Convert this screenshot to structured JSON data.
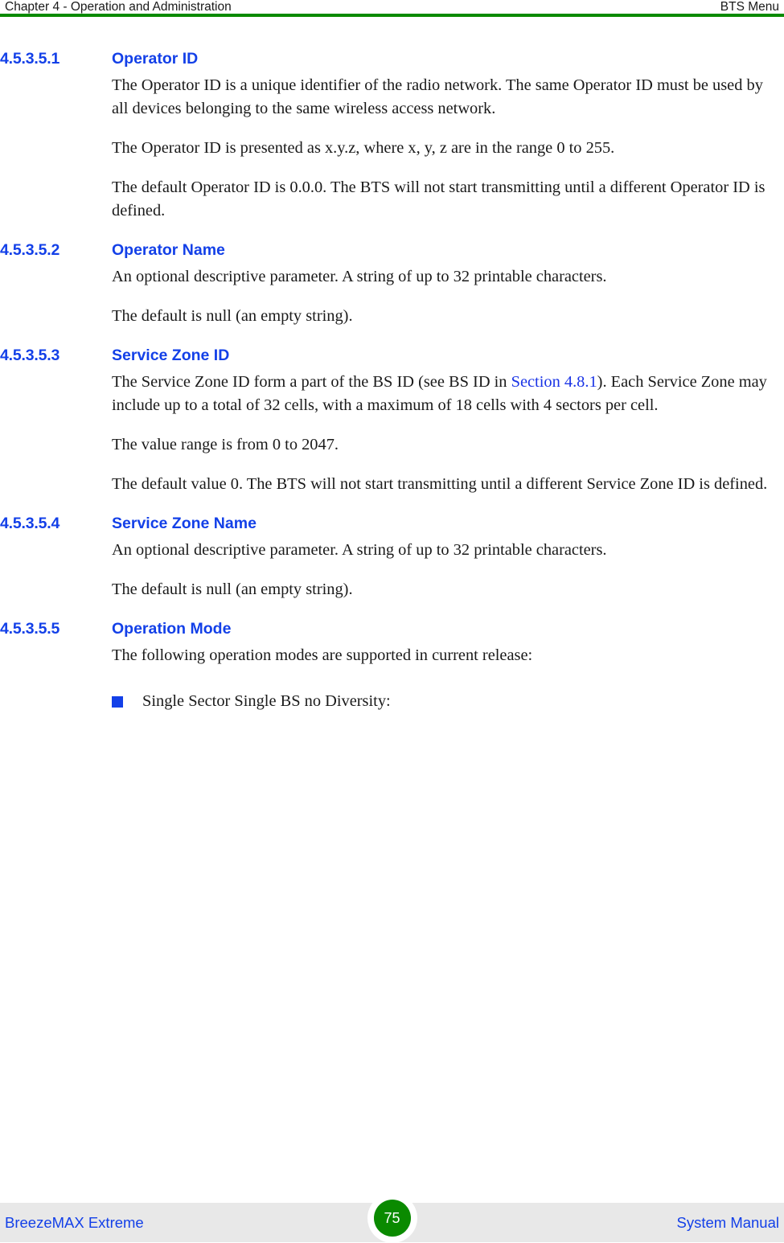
{
  "header": {
    "left": "Chapter 4 - Operation and Administration",
    "right": "BTS Menu",
    "rule_color": "#0a8a00"
  },
  "theme": {
    "heading_color": "#1340e8",
    "link_color": "#1a34e6",
    "body_color": "#1a1a1a",
    "footer_band_color": "#e8e8e8",
    "badge_color": "#0a8a00",
    "bullet_color": "#1340e8"
  },
  "sections": [
    {
      "number": "4.5.3.5.1",
      "title": "Operator ID",
      "paragraphs": [
        "The Operator ID is a unique identifier of the radio network. The same Operator ID must be used by all devices belonging to the same wireless access network.",
        "The Operator ID is presented as x.y.z, where x, y, z are in the range 0 to 255.",
        "The default Operator ID is 0.0.0. The BTS will not start transmitting until a different Operator ID is defined."
      ]
    },
    {
      "number": "4.5.3.5.2",
      "title": "Operator Name",
      "paragraphs": [
        "An optional descriptive parameter. A string of up to 32 printable characters.",
        "The default is null (an empty string)."
      ]
    },
    {
      "number": "4.5.3.5.3",
      "title": "Service Zone ID",
      "paragraphs_rich": [
        {
          "parts": [
            {
              "type": "text",
              "value": "The Service Zone ID form a part of the BS ID (see BS ID in "
            },
            {
              "type": "link",
              "value": "Section 4.8.1"
            },
            {
              "type": "text",
              "value": "). Each Service Zone may include up to a total of 32 cells, with a maximum of 18 cells with 4 sectors per cell."
            }
          ]
        }
      ],
      "paragraphs": [
        "The value range is from 0 to 2047.",
        "The default value 0. The BTS will not start transmitting until a different Service Zone ID is defined."
      ]
    },
    {
      "number": "4.5.3.5.4",
      "title": "Service Zone Name",
      "paragraphs": [
        "An optional descriptive parameter. A string of up to 32 printable characters.",
        "The default is null (an empty string)."
      ]
    },
    {
      "number": "4.5.3.5.5",
      "title": "Operation Mode",
      "paragraphs": [
        "The following operation modes are supported in current release:"
      ],
      "bullets": [
        "Single Sector Single BS no Diversity:"
      ]
    }
  ],
  "footer": {
    "left": "BreezeMAX Extreme",
    "page_number": "75",
    "right": "System Manual"
  }
}
